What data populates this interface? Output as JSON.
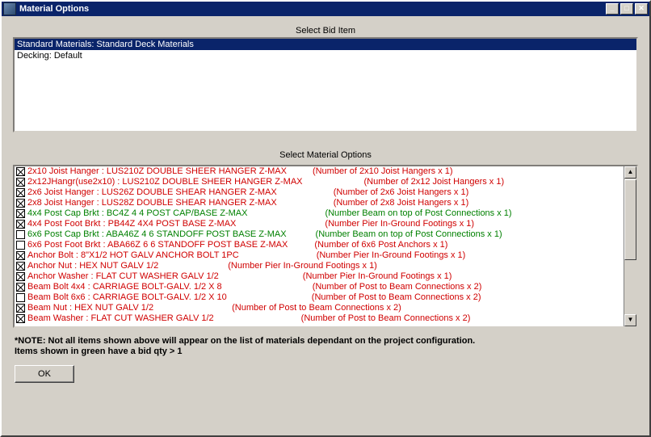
{
  "window": {
    "title": "Material Options"
  },
  "labels": {
    "select_bid": "Select Bid Item",
    "select_material": "Select Material Options"
  },
  "bid_items": [
    {
      "label": "Standard Materials: Standard Deck Materials",
      "selected": true
    },
    {
      "label": "Decking: Default",
      "selected": false
    }
  ],
  "material_rows": [
    {
      "checked": true,
      "color": "red",
      "name": "2x10 Joist Hanger : LUS210Z DOUBLE SHEER HANGER Z-MAX",
      "pad": 32,
      "note": "(Number of 2x10 Joist Hangers x 1)"
    },
    {
      "checked": true,
      "color": "red",
      "name": "2x12JHangr(use2x10) : LUS210Z DOUBLE SHEER HANGER Z-MAX",
      "pad": 76,
      "note": "(Number of 2x12 Joist Hangers x 1)"
    },
    {
      "checked": true,
      "color": "red",
      "name": "2x6 Joist Hanger : LUS26Z DOUBLE SHEAR HANGER Z-MAX",
      "pad": 70,
      "note": "(Number of 2x6 Joist Hangers x 1)"
    },
    {
      "checked": true,
      "color": "red",
      "name": "2x8 Joist Hanger : LUS28Z DOUBLE SHEAR HANGER Z-MAX",
      "pad": 70,
      "note": "(Number of 2x8 Joist Hangers x 1)"
    },
    {
      "checked": true,
      "color": "green",
      "name": "4x4 Post Cap Brkt : BC4Z 4 4 POST CAP/BASE Z-MAX",
      "pad": 96,
      "note": "(Number Beam on top of Post Connections x 1)"
    },
    {
      "checked": true,
      "color": "red",
      "name": "4x4 Post Foot Brkt : PB44Z 4X4 POST BASE Z-MAX",
      "pad": 110,
      "note": "(Number Pier In-Ground Footings x 1)"
    },
    {
      "checked": false,
      "color": "green",
      "name": "6x6 Post Cap Brkt : ABA46Z 4 6 STANDOFF POST BASE Z-MAX",
      "pad": 36,
      "note": "(Number Beam on top of Post Connections x 1)"
    },
    {
      "checked": false,
      "color": "red",
      "name": "6x6 Post Foot Brkt : ABA66Z 6 6 STANDOFF POST BASE Z-MAX",
      "pad": 33,
      "note": "(Number of 6x6 Post Anchors x 1)"
    },
    {
      "checked": true,
      "color": "red",
      "name": "Anchor Bolt : 8\"X1/2 HOT GALV ANCHOR BOLT 1PC",
      "pad": 96,
      "note": "(Number Pier In-Ground Footings x 1)"
    },
    {
      "checked": true,
      "color": "red",
      "name": "Anchor Nut : HEX NUT GALV  1/2",
      "pad": 86,
      "note": "(Number Pier In-Ground Footings x 1)"
    },
    {
      "checked": true,
      "color": "red",
      "name": "Anchor Washer : FLAT CUT WASHER GALV  1/2",
      "pad": 104,
      "note": "(Number Pier In-Ground Footings x 1)"
    },
    {
      "checked": true,
      "color": "red",
      "name": "Beam Bolt 4x4 : CARRIAGE BOLT-GALV. 1/2 X 8",
      "pad": 112,
      "note": "(Number of Post to Beam Connections x 2)"
    },
    {
      "checked": false,
      "color": "red",
      "name": "Beam Bolt 6x6 : CARRIAGE BOLT-GALV. 1/2 X 10",
      "pad": 105,
      "note": "(Number of Post to Beam Connections x 2)"
    },
    {
      "checked": true,
      "color": "red",
      "name": "Beam Nut : HEX NUT GALV  1/2",
      "pad": 97,
      "note": "(Number of Post to Beam Connections x 2)"
    },
    {
      "checked": true,
      "color": "red",
      "name": "Beam Washer : FLAT CUT WASHER GALV  1/2",
      "pad": 108,
      "note": "(Number of Post to Beam Connections x 2)"
    }
  ],
  "note": {
    "line1": "*NOTE:  Not all items shown above will appear on the list of materials dependant on the project configuration.",
    "line2": "Items shown in green have a bid qty > 1"
  },
  "buttons": {
    "ok": "OK"
  }
}
